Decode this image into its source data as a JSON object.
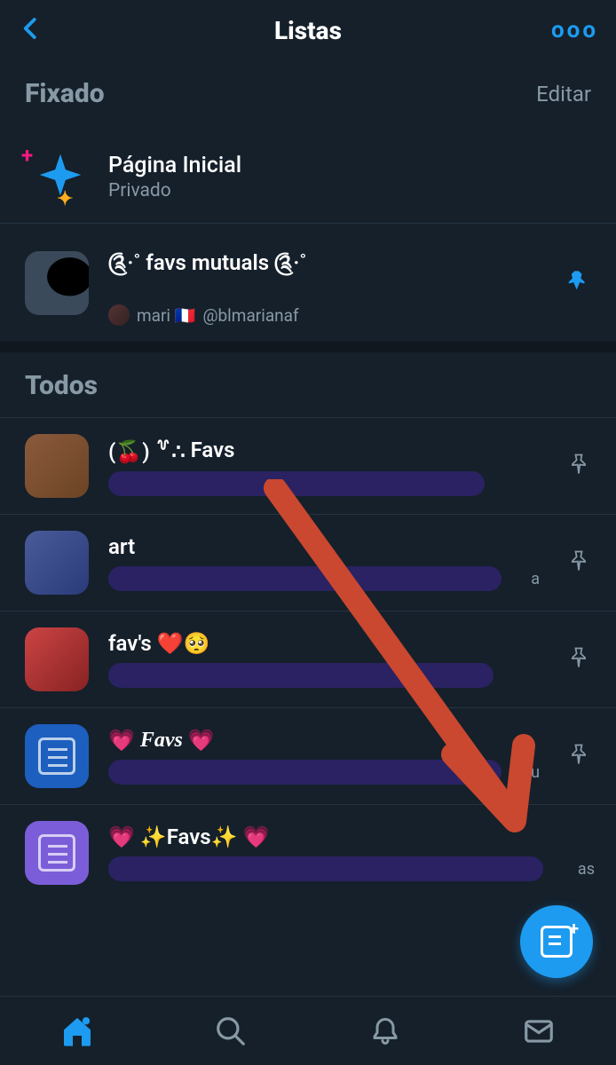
{
  "header": {
    "title": "Listas"
  },
  "sections": {
    "pinned_label": "Fixado",
    "edit_label": "Editar",
    "all_label": "Todos"
  },
  "pinned": [
    {
      "title": "Página Inicial",
      "subtitle": "Privado"
    },
    {
      "title": "༊·˚ favs mutuals ༊·˚",
      "author_name": "mari 🇫🇷",
      "author_handle": "@blmarianaf",
      "pinned_state": true
    }
  ],
  "lists": [
    {
      "title_prefix": "(🍒) ꒷∴",
      "title_text": "Favs",
      "redacted": true
    },
    {
      "title_text": "art",
      "redacted": true,
      "peek": "a"
    },
    {
      "title_text": "fav's ❤️🥺",
      "redacted": true
    },
    {
      "title_emoji_l": "💗",
      "title_italic": "Favs",
      "title_emoji_r": "💗",
      "redacted": true,
      "peek": "ou"
    },
    {
      "title_text": "💗 ✨Favs✨ 💗",
      "redacted": true,
      "peek": "as"
    }
  ],
  "colors": {
    "accent": "#1d9bf0",
    "bg": "#15202b",
    "muted": "#8899a6",
    "annotation": "#c9482f"
  }
}
